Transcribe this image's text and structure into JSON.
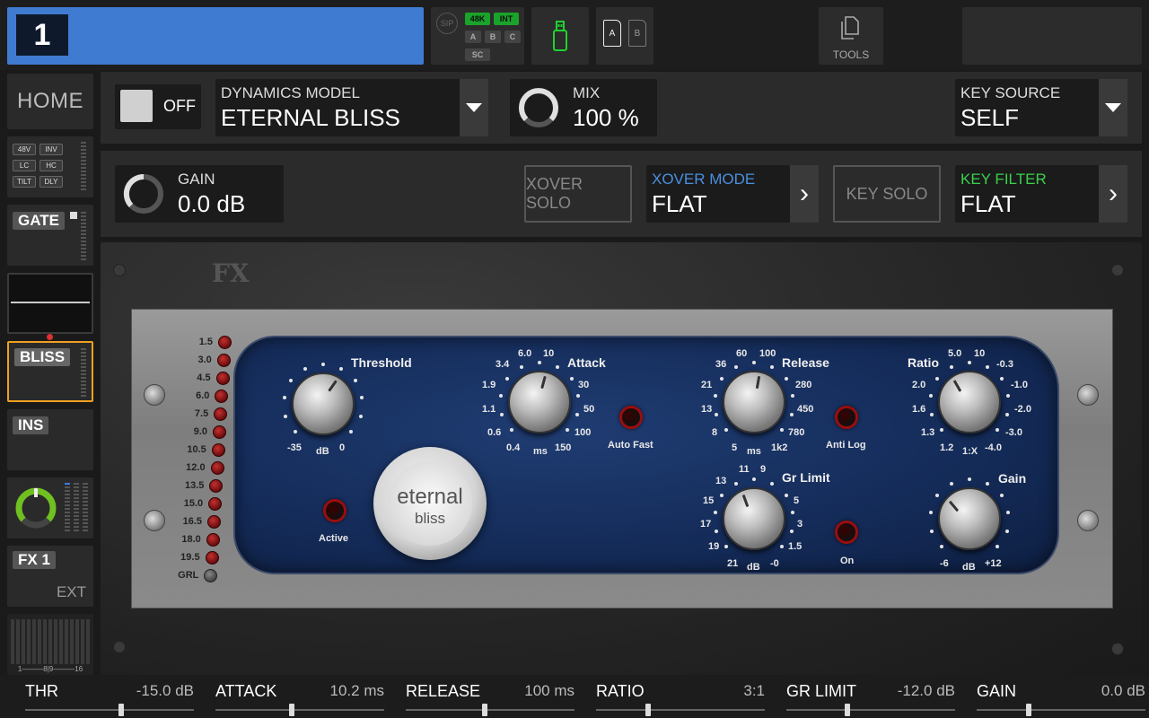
{
  "channel": {
    "number": "1"
  },
  "status": {
    "sip": "SIP",
    "tags": {
      "k48": "48K",
      "int": "INT",
      "a": "A",
      "b": "B",
      "c": "C",
      "sc": "SC"
    },
    "card_a": "A",
    "card_b": "B",
    "tools_label": "TOOLS"
  },
  "sidebar": {
    "home": "HOME",
    "preamp_tags": [
      "48V",
      "INV",
      "LC",
      "HC",
      "TILT",
      "DLY"
    ],
    "gate": "GATE",
    "bliss": "BLISS",
    "ins": "INS",
    "fx1": "FX 1",
    "ext": "EXT",
    "meter_scale": "1———8|9———16"
  },
  "row1": {
    "toggle_label": "OFF",
    "model_label": "DYNAMICS MODEL",
    "model_value": "ETERNAL BLISS",
    "mix_label": "MIX",
    "mix_value": "100 %",
    "key_source_label": "KEY SOURCE",
    "key_source_value": "SELF"
  },
  "row2": {
    "gain_label": "GAIN",
    "gain_value": "0.0 dB",
    "xover_solo": "XOVER SOLO",
    "xover_mode_label": "XOVER MODE",
    "xover_mode_value": "FLAT",
    "key_solo": "KEY SOLO",
    "key_filter_label": "KEY FILTER",
    "key_filter_value": "FLAT",
    "next_glyph": "›"
  },
  "plugin": {
    "fx_logo": "FX",
    "logo_line1": "eternal",
    "logo_line2": "bliss",
    "led_labels": [
      "1.5",
      "3.0",
      "4.5",
      "6.0",
      "7.5",
      "9.0",
      "10.5",
      "12.0",
      "13.5",
      "15.0",
      "16.5",
      "18.0",
      "19.5",
      "GRL"
    ],
    "threshold": {
      "title": "Threshold",
      "min": "-35",
      "unit": "dB",
      "max": "0"
    },
    "attack": {
      "title": "Attack",
      "scale": [
        "0.6",
        "1.1",
        "1.9",
        "3.4",
        "6.0",
        "10",
        "30",
        "50",
        "100",
        "150"
      ],
      "min": "0.4",
      "unit": "ms"
    },
    "auto_fast": "Auto Fast",
    "release": {
      "title": "Release",
      "scale": [
        "8",
        "13",
        "21",
        "36",
        "60",
        "100",
        "280",
        "450",
        "780"
      ],
      "min": "5",
      "unit": "ms",
      "max": "1k2"
    },
    "anti_log": "Anti Log",
    "ratio": {
      "title": "Ratio",
      "scale": [
        "1.3",
        "1.6",
        "2.0",
        "5.0",
        "10",
        "-0.3",
        "-1.0",
        "-2.0",
        "-3.0"
      ],
      "min": "1.2",
      "unit": "1:X",
      "max": "-4.0"
    },
    "gr_limit": {
      "title": "Gr Limit",
      "scale": [
        "19",
        "17",
        "15",
        "13",
        "11",
        "9",
        "5",
        "3",
        "1.5"
      ],
      "min": "21",
      "unit": "dB",
      "max": "-0"
    },
    "on": "On",
    "gain": {
      "title": "Gain",
      "min": "-6",
      "unit": "dB",
      "max": "+12"
    },
    "active": "Active"
  },
  "bottom": [
    {
      "label": "THR",
      "value": "-15.0 dB",
      "level": 0.57
    },
    {
      "label": "ATTACK",
      "value": "10.2 ms",
      "level": 0.45
    },
    {
      "label": "RELEASE",
      "value": "100 ms",
      "level": 0.47
    },
    {
      "label": "RATIO",
      "value": "3:1",
      "level": 0.31
    },
    {
      "label": "GR LIMIT",
      "value": "-12.0 dB",
      "level": 0.36
    },
    {
      "label": "GAIN",
      "value": "0.0 dB",
      "level": 0.31
    }
  ],
  "colors": {
    "accent_blue": "#3f7bd1",
    "xover_label": "#4a8fe0",
    "key_filter_label": "#39d04a",
    "selected_border": "#f0a020",
    "red_button_ring": "#9a0d0d"
  }
}
